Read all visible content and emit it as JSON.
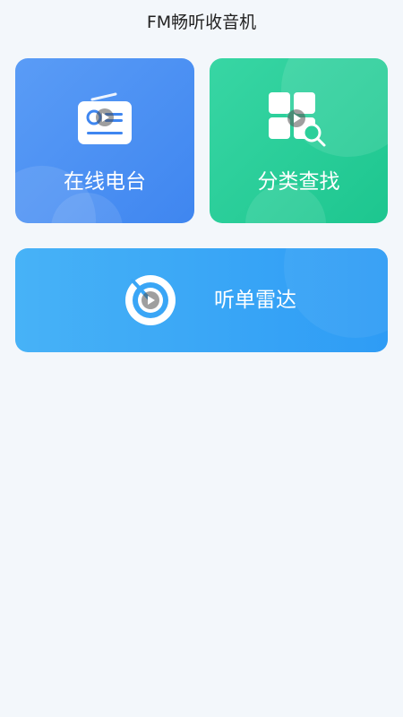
{
  "header": {
    "title": "FM畅听收音机"
  },
  "cards": {
    "online_radio": {
      "label": "在线电台",
      "icon": "radio-icon"
    },
    "category_search": {
      "label": "分类查找",
      "icon": "category-search-icon"
    },
    "playlist_radar": {
      "label": "听单雷达",
      "icon": "radar-icon"
    }
  },
  "colors": {
    "background": "#f3f7fb",
    "radio_card": "#4a90f3",
    "category_card": "#2ccf9a",
    "radar_card": "#3aa6f6"
  }
}
